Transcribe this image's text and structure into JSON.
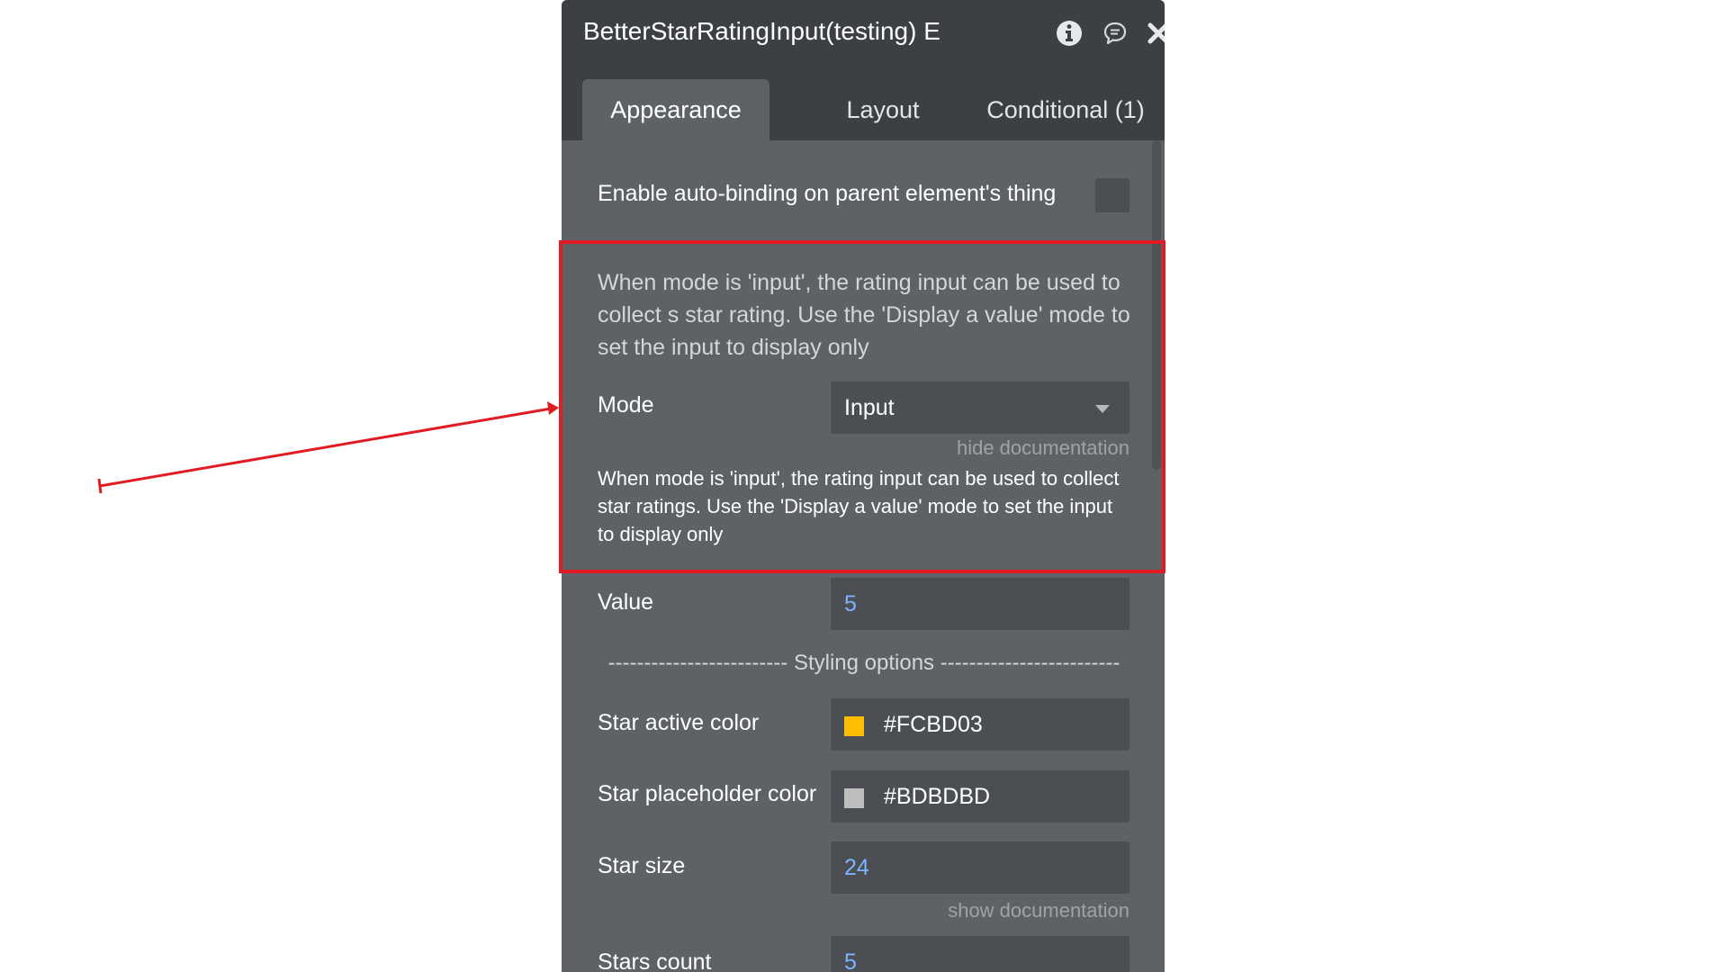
{
  "window": {
    "title": "BetterStarRatingInput(testing) E",
    "icons": [
      "info-icon",
      "comment-icon",
      "close-icon"
    ]
  },
  "tabs": [
    {
      "label": "Appearance",
      "active": true
    },
    {
      "label": "Layout",
      "active": false
    },
    {
      "label": "Conditional (1)",
      "active": false
    }
  ],
  "autobind": {
    "label": "Enable auto-binding on parent element's thing",
    "checked": false
  },
  "mode_doc": "When mode is 'input', the rating input can be used to collect s star rating. Use the 'Display a value' mode to set the input to display only",
  "mode": {
    "label": "Mode",
    "value": "Input",
    "hide_doc_link": "hide documentation",
    "doc_expanded": "When mode is 'input', the rating input can be used to collect star ratings. Use the 'Display a value' mode to set the input to display only"
  },
  "value_field": {
    "label": "Value",
    "value": "5"
  },
  "styling_header": "------------------------- Styling options -------------------------",
  "star_active_color": {
    "label": "Star active color",
    "value": "#FCBD03",
    "color": "#FCBD03"
  },
  "star_placeholder_color": {
    "label": "Star placeholder color",
    "value": "#BDBDBD",
    "color": "#BDBDBD"
  },
  "star_size": {
    "label": "Star size",
    "value": "24",
    "show_doc_link": "show documentation"
  },
  "stars_count": {
    "label": "Stars count",
    "value": "5"
  },
  "annotation": {
    "highlight_color": "#E01C22"
  }
}
